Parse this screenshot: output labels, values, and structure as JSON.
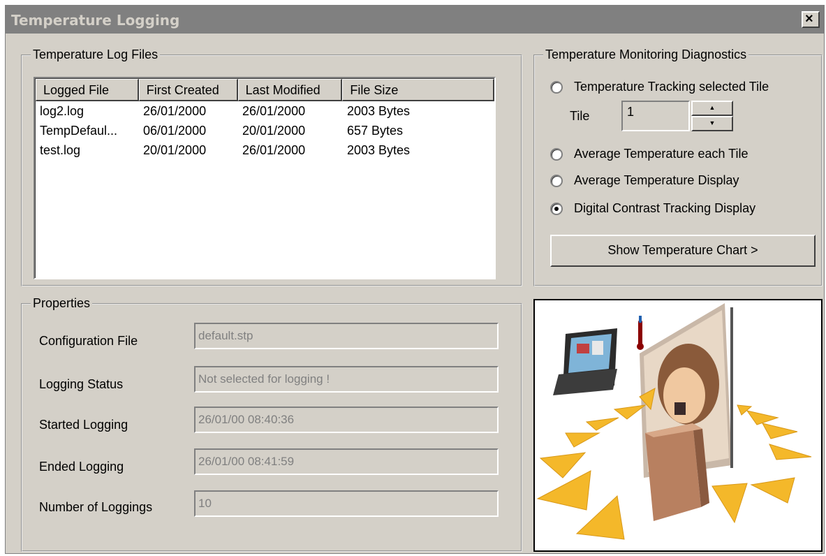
{
  "window": {
    "title": "Temperature Logging",
    "close_glyph": "×"
  },
  "log_files": {
    "legend": "Temperature Log Files",
    "columns": [
      "Logged File",
      "First Created",
      "Last Modified",
      "File Size"
    ],
    "rows": [
      [
        "log2.log",
        "26/01/2000",
        "26/01/2000",
        "2003 Bytes"
      ],
      [
        "TempDefaul...",
        "06/01/2000",
        "20/01/2000",
        "657 Bytes"
      ],
      [
        "test.log",
        "20/01/2000",
        "26/01/2000",
        "2003 Bytes"
      ]
    ]
  },
  "properties": {
    "legend": "Properties",
    "fields": [
      {
        "label": "Configuration File",
        "value": "default.stp"
      },
      {
        "label": "Logging Status",
        "value": "Not selected for logging !"
      },
      {
        "label": "Started Logging",
        "value": "26/01/00  08:40:36"
      },
      {
        "label": "Ended Logging",
        "value": "26/01/00  08:41:59"
      },
      {
        "label": "Number of Loggings",
        "value": "10"
      }
    ]
  },
  "diagnostics": {
    "legend": "Temperature Monitoring Diagnostics",
    "options": [
      {
        "label": "Temperature Tracking selected Tile",
        "selected": false
      },
      {
        "label": "Average Temperature each Tile",
        "selected": false
      },
      {
        "label": "Average Temperature Display",
        "selected": false
      },
      {
        "label": "Digital Contrast Tracking Display",
        "selected": true
      }
    ],
    "tile_label": "Tile",
    "tile_value": "1",
    "spin_up": "▲",
    "spin_down": "▼",
    "chart_button": "Show Temperature Chart >"
  }
}
